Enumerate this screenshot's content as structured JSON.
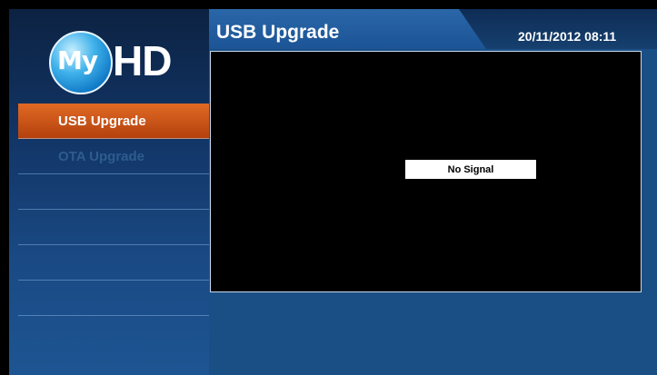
{
  "header": {
    "title": "USB Upgrade",
    "datetime": "20/11/2012 08:11"
  },
  "logo": {
    "my": "My",
    "hd": "HD"
  },
  "sidebar": {
    "items": [
      {
        "label": "USB Upgrade",
        "state": "selected"
      },
      {
        "label": "OTA Upgrade",
        "state": "disabled"
      },
      {
        "label": ""
      },
      {
        "label": ""
      },
      {
        "label": ""
      },
      {
        "label": ""
      }
    ]
  },
  "video": {
    "status": "No Signal"
  },
  "colors": {
    "accent": "#d2561b",
    "background": "#1a4f86",
    "sidebar": "#123566"
  }
}
